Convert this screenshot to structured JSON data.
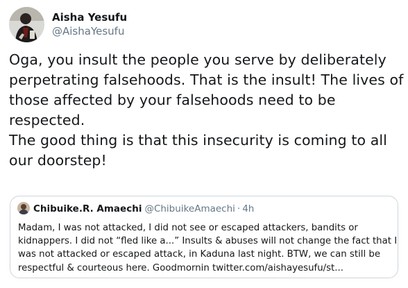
{
  "tweet": {
    "author_name": "Aisha Yesufu",
    "author_handle": "@AishaYesufu",
    "text_lines": [
      "Oga, you insult the people you serve by deliberately",
      "perpetrating falsehoods. That is the insult! The lives of",
      "those affected by your falsehoods need to be",
      "respected.",
      "The good thing is that this insecurity is coming to all",
      "our doorstep!"
    ]
  },
  "quoted_tweet": {
    "author_name": "Chibuike.R. Amaechi",
    "author_handle": "@ChibuikeAmaechi",
    "separator": "·",
    "time": "4h",
    "text_lines": [
      "Madam, I was not attacked, I did not see or escaped attackers, bandits or",
      "kidnappers. I did not “fled like a...” Insults & abuses will not change the fact that I",
      "was not attacked or escaped attack, in Kaduna last night. BTW, we can still be",
      "respectful & courteous here. Goodmornin twitter.com/aishayesufu/st..."
    ]
  },
  "colors": {
    "text_primary": "#14171a",
    "text_secondary": "#657786",
    "border": "#ccd6dd",
    "background": "#ffffff"
  },
  "icons": {
    "author_avatar": "profile-photo",
    "quoted_avatar": "profile-photo"
  }
}
